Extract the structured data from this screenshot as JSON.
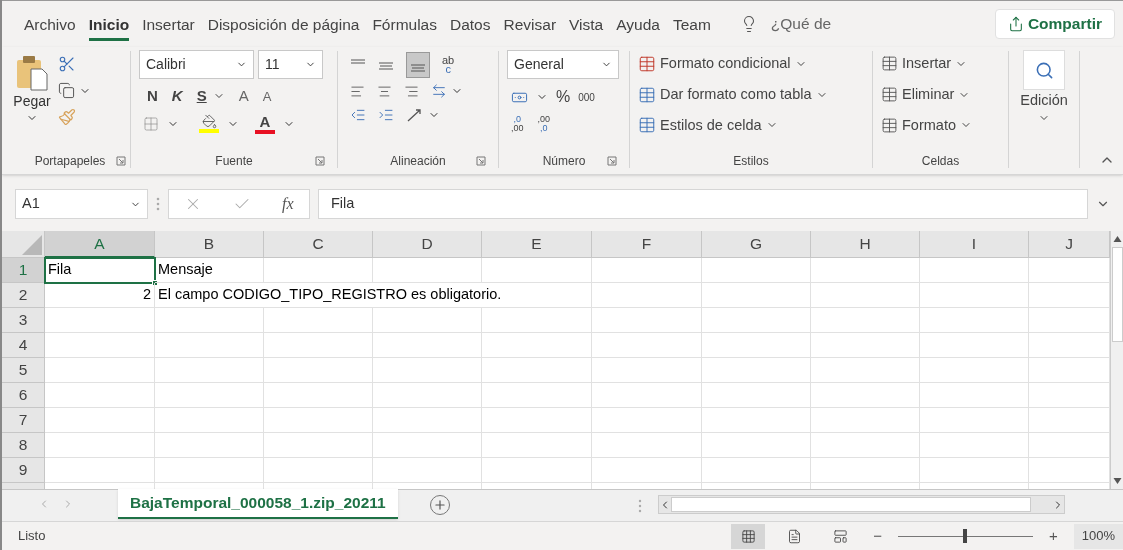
{
  "tabs": [
    {
      "label": "Archivo",
      "selected": false
    },
    {
      "label": "Inicio",
      "selected": true
    },
    {
      "label": "Insertar",
      "selected": false
    },
    {
      "label": "Disposición de página",
      "selected": false
    },
    {
      "label": "Fórmulas",
      "selected": false
    },
    {
      "label": "Datos",
      "selected": false
    },
    {
      "label": "Revisar",
      "selected": false
    },
    {
      "label": "Vista",
      "selected": false
    },
    {
      "label": "Ayuda",
      "selected": false
    },
    {
      "label": "Team",
      "selected": false
    }
  ],
  "tell_me": "¿Qué de",
  "share_button": "Compartir",
  "ribbon": {
    "clipboard": {
      "label": "Portapapeles",
      "paste": "Pegar"
    },
    "font": {
      "label": "Fuente",
      "font_name": "Calibri",
      "font_size": "11",
      "bold": "N",
      "italic": "K",
      "underline": "S",
      "grow": "A",
      "shrink": "A",
      "font_color": "A"
    },
    "alignment": {
      "label": "Alineación",
      "wrap_glyphs": [
        "ab",
        "c"
      ]
    },
    "number": {
      "label": "Número",
      "format": "General",
      "percent": "%",
      "thousands": "000",
      "increase_decimal": [
        ",0",
        ",00"
      ],
      "decrease_decimal": [
        ",00",
        ",0"
      ]
    },
    "styles": {
      "label": "Estilos",
      "items": [
        "Formato condicional",
        "Dar formato como tabla",
        "Estilos de celda"
      ]
    },
    "cells": {
      "label": "Celdas",
      "items": [
        "Insertar",
        "Eliminar",
        "Formato"
      ]
    },
    "editing": {
      "label": "Edición"
    }
  },
  "formula_bar": {
    "name_box": "A1",
    "fx": "fx",
    "value": "Fila"
  },
  "grid": {
    "columns": [
      {
        "label": "A",
        "selected": true
      },
      {
        "label": "B",
        "selected": false
      },
      {
        "label": "C",
        "selected": false
      },
      {
        "label": "D",
        "selected": false
      },
      {
        "label": "E",
        "selected": false
      },
      {
        "label": "F",
        "selected": false
      },
      {
        "label": "G",
        "selected": false
      },
      {
        "label": "H",
        "selected": false
      },
      {
        "label": "I",
        "selected": false
      },
      {
        "label": "J",
        "selected": false
      }
    ],
    "rows": [
      {
        "number": "1",
        "selected": true,
        "cells": [
          {
            "text": "Fila",
            "kind": "text",
            "selected": true
          },
          {
            "text": "Mensaje",
            "kind": "text",
            "selected": false
          }
        ]
      },
      {
        "number": "2",
        "selected": false,
        "cells": [
          {
            "text": "2",
            "kind": "number",
            "selected": false
          },
          {
            "text": "El campo CODIGO_TIPO_REGISTRO es obligatorio.",
            "kind": "text",
            "selected": false
          }
        ]
      },
      {
        "number": "3",
        "selected": false,
        "cells": []
      },
      {
        "number": "4",
        "selected": false,
        "cells": []
      },
      {
        "number": "5",
        "selected": false,
        "cells": []
      },
      {
        "number": "6",
        "selected": false,
        "cells": []
      },
      {
        "number": "7",
        "selected": false,
        "cells": []
      },
      {
        "number": "8",
        "selected": false,
        "cells": []
      },
      {
        "number": "9",
        "selected": false,
        "cells": []
      }
    ]
  },
  "sheet_tabs": [
    {
      "label": "BajaTemporal_000058_1.zip_20211",
      "selected": true
    }
  ],
  "status": {
    "text": "Listo",
    "zoom": "100%",
    "zoom_out": "−",
    "zoom_in": "+",
    "zoom_slider": {
      "level": 0.5
    },
    "views": [
      {
        "kind": "normal",
        "selected": true
      },
      {
        "kind": "page_layout",
        "selected": false
      },
      {
        "kind": "page_break",
        "selected": false
      }
    ]
  }
}
